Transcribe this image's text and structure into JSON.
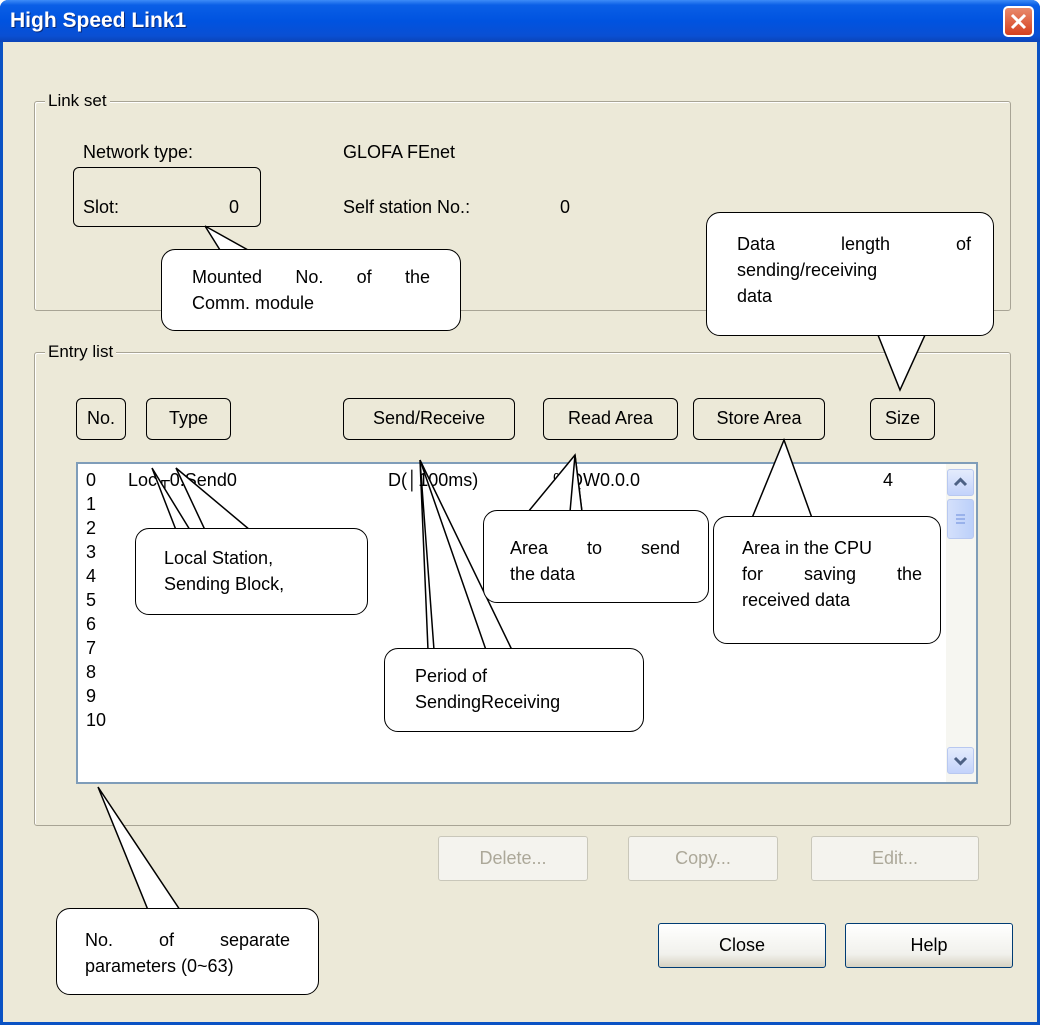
{
  "window": {
    "title": "High Speed Link1"
  },
  "link_set": {
    "legend": "Link set",
    "network_type_label": "Network type:",
    "network_type_value": "GLOFA FEnet",
    "slot_label": "Slot:",
    "slot_value": "0",
    "self_station_label": "Self station No.:",
    "self_station_value": "0"
  },
  "entry_list": {
    "legend": "Entry list",
    "headers": {
      "no": "No.",
      "type": "Type",
      "send_receive": "Send/Receive",
      "read_area": "Read Area",
      "store_area": "Store Area",
      "size": "Size"
    },
    "rows": [
      {
        "no": "0",
        "type": "Loc╓0.Send0",
        "send_receive": "D(│100ms)",
        "read_area": "%QW0.0.0",
        "size": "4"
      },
      {
        "no": "1"
      },
      {
        "no": "2"
      },
      {
        "no": "3"
      },
      {
        "no": "4"
      },
      {
        "no": "5"
      },
      {
        "no": "6"
      },
      {
        "no": "7"
      },
      {
        "no": "8"
      },
      {
        "no": "9"
      },
      {
        "no": "10"
      }
    ]
  },
  "buttons": {
    "delete": "Delete...",
    "copy": "Copy...",
    "edit": "Edit...",
    "close": "Close",
    "help": "Help"
  },
  "callouts": {
    "mounted": [
      "Mounted No. of the",
      "Comm. module"
    ],
    "data_length": [
      "Data length of",
      "sending/receiving",
      "data"
    ],
    "local_station": [
      "Local Station,",
      "Sending Block,"
    ],
    "area_send": [
      "Area to send",
      "the data"
    ],
    "area_cpu": [
      "Area in the CPU",
      "for saving the",
      "received data"
    ],
    "period": [
      "Period of",
      "SendingReceiving"
    ],
    "no_params": [
      "No. of separate",
      "parameters (0~63)"
    ]
  },
  "icons": {
    "close": "close-icon",
    "scroll_up": "chevron-up-icon",
    "scroll_down": "chevron-down-icon"
  }
}
